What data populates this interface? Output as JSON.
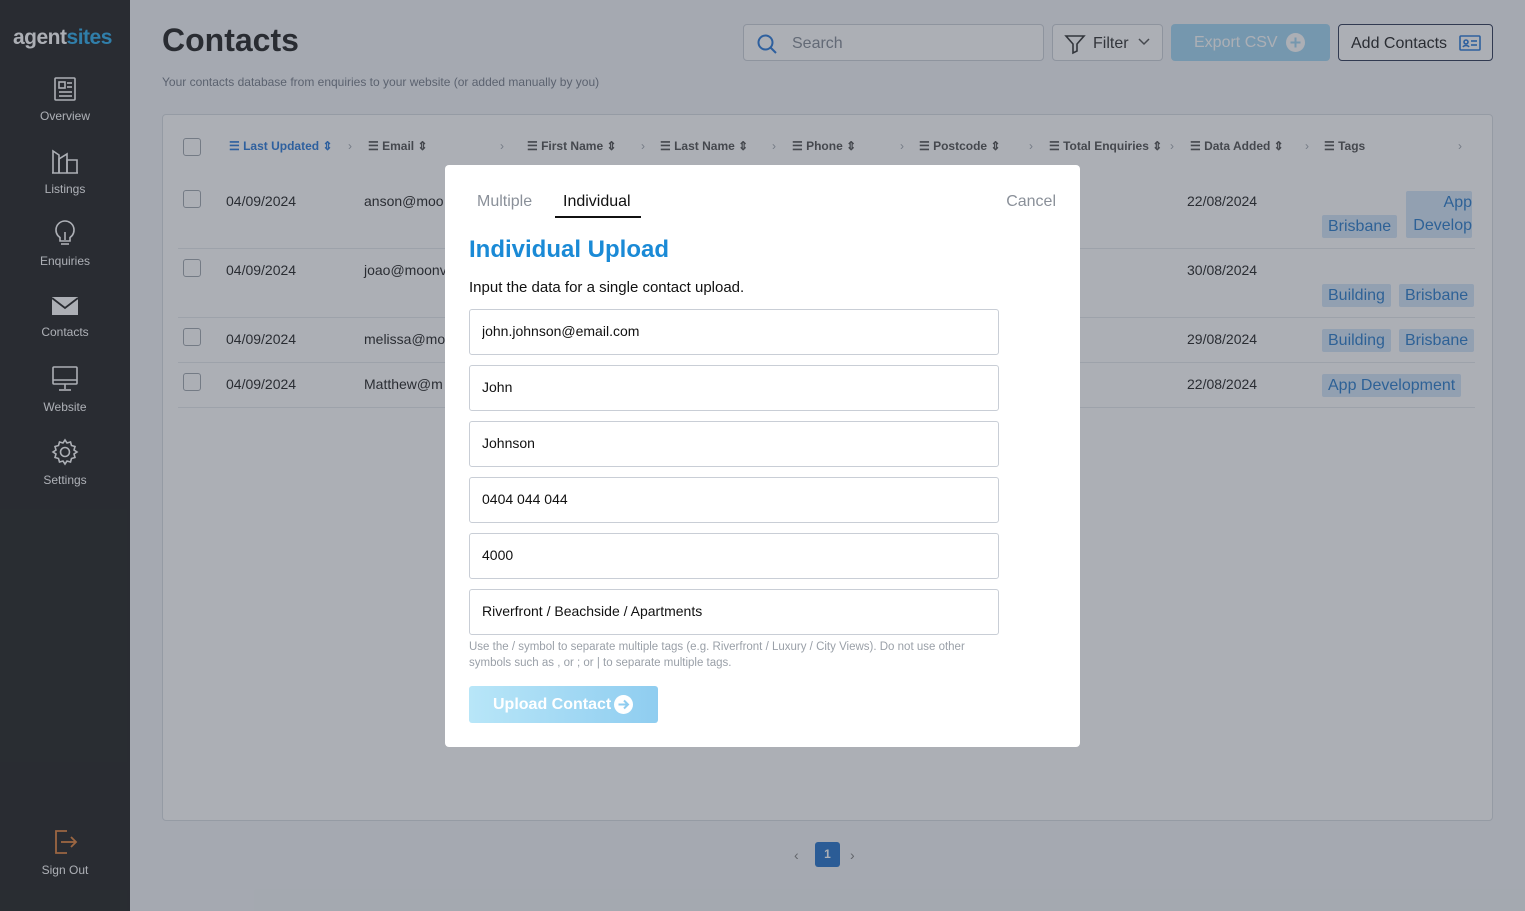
{
  "brand": {
    "part1": "agent",
    "part2": "sites"
  },
  "sidebar": {
    "items": [
      {
        "label": "Overview",
        "icon": "newspaper-icon"
      },
      {
        "label": "Listings",
        "icon": "building-icon"
      },
      {
        "label": "Enquiries",
        "icon": "lightbulb-icon"
      },
      {
        "label": "Contacts",
        "icon": "envelope-icon",
        "active": true
      },
      {
        "label": "Website",
        "icon": "monitor-icon"
      },
      {
        "label": "Settings",
        "icon": "gear-icon"
      }
    ],
    "signout": {
      "label": "Sign Out",
      "icon": "sign-out-icon"
    }
  },
  "header": {
    "title": "Contacts",
    "subtitle": "Your contacts database from enquiries to your website (or added manually by you)",
    "search_placeholder": "Search",
    "filter_label": "Filter",
    "export_label": "Export CSV",
    "add_label": "Add Contacts"
  },
  "table": {
    "columns": [
      "Last Updated",
      "Email",
      "First Name",
      "Last Name",
      "Phone",
      "Postcode",
      "Total Enquiries",
      "Data Added",
      "Tags"
    ],
    "rows": [
      {
        "last_updated": "04/09/2024",
        "email": "anson@moo",
        "date_added": "22/08/2024",
        "tags": [
          "Brisbane",
          "App Develop"
        ]
      },
      {
        "last_updated": "04/09/2024",
        "email": "joao@moonv",
        "date_added": "30/08/2024",
        "tags": [
          "Building",
          "Brisbane"
        ]
      },
      {
        "last_updated": "04/09/2024",
        "email": "melissa@mo",
        "date_added": "29/08/2024",
        "tags": [
          "Building",
          "Brisbane"
        ]
      },
      {
        "last_updated": "04/09/2024",
        "email": "Matthew@m",
        "date_added": "22/08/2024",
        "tags": [
          "App Development"
        ]
      }
    ]
  },
  "pagination": {
    "current": "1",
    "prev": "‹",
    "next": "›"
  },
  "modal": {
    "tab_multiple": "Multiple",
    "tab_individual": "Individual",
    "cancel_label": "Cancel",
    "title": "Individual Upload",
    "subtitle": "Input the data for a single contact upload.",
    "fields": {
      "email": "john.johnson@email.com",
      "first_name": "John",
      "last_name": "Johnson",
      "phone": "0404 044 044",
      "postcode": "4000",
      "tags": "Riverfront / Beachside / Apartments"
    },
    "hint": "Use the / symbol to separate multiple tags (e.g. Riverfront / Luxury / City Views). Do not use other symbols such as , or ; or | to separate multiple tags.",
    "upload_label": "Upload Contact"
  },
  "colors": {
    "accent": "#1a8ad6",
    "sidebar": "#111111",
    "page_number": "#1569c7"
  }
}
